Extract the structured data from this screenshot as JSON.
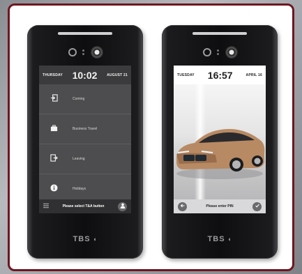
{
  "devices": {
    "left": {
      "status": {
        "day": "THURSDAY",
        "time": "10:02",
        "date": "AUGUST 21"
      },
      "menu": [
        {
          "icon": "login-icon",
          "label": "Coming"
        },
        {
          "icon": "briefcase-icon",
          "label": "Business Travel"
        },
        {
          "icon": "logout-icon",
          "label": "Leaving"
        },
        {
          "icon": "info-icon",
          "label": "Holidays"
        }
      ],
      "bottom_text": "Please select T&A button",
      "brand": "TBS"
    },
    "right": {
      "status": {
        "day": "TUESDAY",
        "time": "16:57",
        "date": "APRIL 16"
      },
      "bottom_text": "Please enter PIN",
      "brand": "TBS"
    }
  },
  "colors": {
    "frame_border": "#6e1620",
    "car": "#b88a63"
  }
}
